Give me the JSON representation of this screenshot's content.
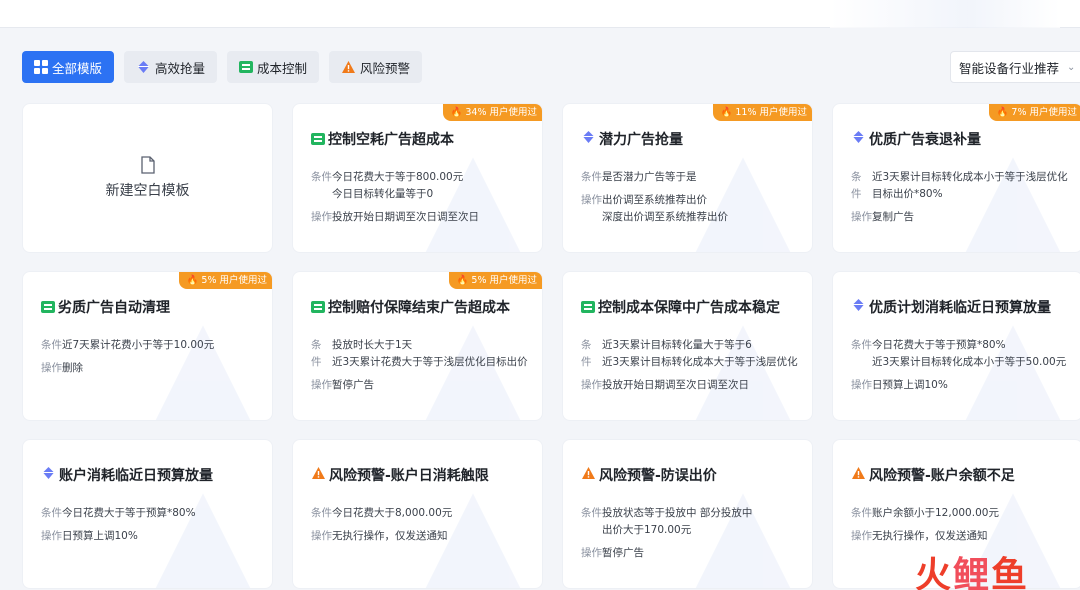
{
  "filters": [
    {
      "label": "全部模版",
      "icon": "grid-icon",
      "active": true
    },
    {
      "label": "高效抢量",
      "icon": "diamond-icon",
      "active": false
    },
    {
      "label": "成本控制",
      "icon": "bars-icon",
      "active": false
    },
    {
      "label": "风险预警",
      "icon": "warning-icon",
      "active": false
    }
  ],
  "dropdown": {
    "value": "智能设备行业推荐"
  },
  "new_card": {
    "label": "新建空白模板"
  },
  "labels": {
    "condition": "条件",
    "action": "操作",
    "cond_1": "条",
    "cond_2": "件"
  },
  "colors": {
    "accent": "#2c72f3",
    "badge": "#f59a23",
    "diamond": "#6a7cf5",
    "bars": "#22b55f",
    "warning": "#f07a1a"
  },
  "cards": [
    {
      "title": "控制空耗广告超成本",
      "icon": "bars-icon",
      "badge": "34% 用户使用过",
      "conditions": [
        "今日花费大于等于800.00元",
        "今日目标转化量等于0"
      ],
      "actions": [
        "投放开始日期调至次日调至次日"
      ]
    },
    {
      "title": "潜力广告抢量",
      "icon": "diamond-icon",
      "badge": "11% 用户使用过",
      "conditions": [
        "是否潜力广告等于是"
      ],
      "actions": [
        "出价调至系统推荐出价",
        "深度出价调至系统推荐出价"
      ]
    },
    {
      "title": "优质广告衰退补量",
      "icon": "diamond-icon",
      "badge": "7% 用户使用过",
      "conditions": [
        "近3天累计目标转化成本小于等于浅层优化",
        "目标出价*80%"
      ],
      "actions": [
        "复制广告"
      ],
      "split": true
    },
    {
      "title": "劣质广告自动清理",
      "icon": "bars-icon",
      "badge": "5% 用户使用过",
      "conditions": [
        "近7天累计花费小于等于10.00元"
      ],
      "actions": [
        "删除"
      ]
    },
    {
      "title": "控制赔付保障结束广告超成本",
      "icon": "bars-icon",
      "badge": "5% 用户使用过",
      "conditions": [
        "投放时长大于1天",
        "近3天累计花费大于等于浅层优化目标出价"
      ],
      "actions": [
        "暂停广告"
      ],
      "split": true
    },
    {
      "title": "控制成本保障中广告成本稳定",
      "icon": "bars-icon",
      "badge": "",
      "conditions": [
        "近3天累计目标转化量大于等于6",
        "近3天累计目标转化成本大于等于浅层优化"
      ],
      "actions": [
        "投放开始日期调至次日调至次日"
      ],
      "split": true
    },
    {
      "title": "优质计划消耗临近日预算放量",
      "icon": "diamond-icon",
      "badge": "",
      "conditions": [
        "今日花费大于等于预算*80%",
        "近3天累计目标转化成本小于等于50.00元"
      ],
      "actions": [
        "日预算上调10%"
      ]
    },
    {
      "title": "账户消耗临近日预算放量",
      "icon": "diamond-icon",
      "badge": "",
      "conditions": [
        "今日花费大于等于预算*80%"
      ],
      "actions": [
        "日预算上调10%"
      ]
    },
    {
      "title": "风险预警-账户日消耗触限",
      "icon": "warning-icon",
      "badge": "",
      "conditions": [
        "今日花费大于8,000.00元"
      ],
      "actions": [
        "无执行操作，仅发送通知"
      ]
    },
    {
      "title": "风险预警-防误出价",
      "icon": "warning-icon",
      "badge": "",
      "conditions": [
        "投放状态等于投放中 部分投放中",
        "出价大于170.00元"
      ],
      "actions": [
        "暂停广告"
      ]
    },
    {
      "title": "风险预警-账户余额不足",
      "icon": "warning-icon",
      "badge": "",
      "conditions": [
        "账户余额小于12,000.00元"
      ],
      "actions": [
        "无执行操作，仅发送通知"
      ]
    }
  ],
  "watermark": {
    "chars": [
      "火",
      "鲤",
      "鱼"
    ]
  }
}
